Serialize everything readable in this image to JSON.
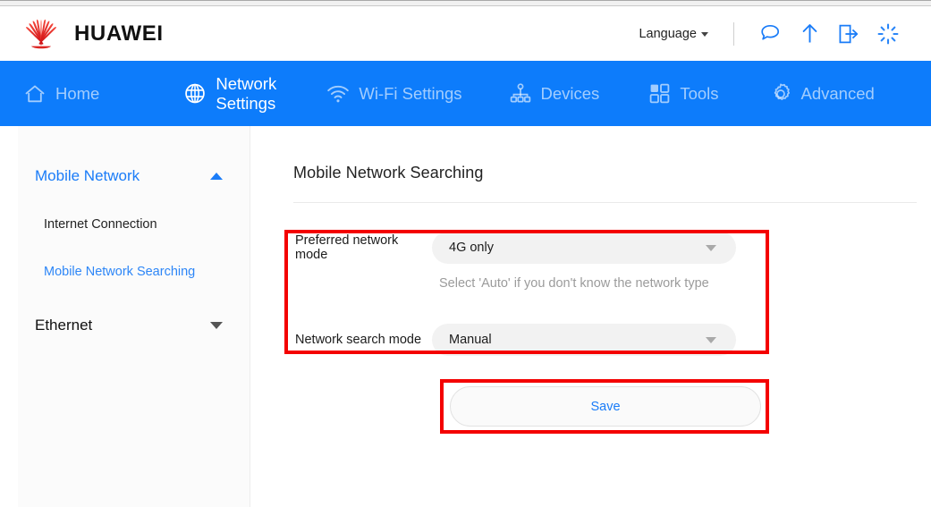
{
  "colors": {
    "nav_blue": "#0d7cfb",
    "link_blue": "#1a7cf8",
    "annotation_red": "#f40000",
    "brand_red": "#e32119",
    "field_gray": "#f2f2f2",
    "hint_gray": "#9b9b9b"
  },
  "header": {
    "brand_name": "HUAWEI",
    "logo_icon": "huawei-flower-logo",
    "language_label": "Language",
    "language_caret_icon": "caret-down-icon",
    "icons": [
      {
        "name": "sms-icon",
        "glyph": "speech-bubble"
      },
      {
        "name": "update-icon",
        "glyph": "arrow-up"
      },
      {
        "name": "logout-icon",
        "glyph": "box-arrow-right"
      },
      {
        "name": "reboot-icon",
        "glyph": "starburst-spinner"
      }
    ]
  },
  "nav": {
    "items": [
      {
        "id": "home",
        "label": "Home",
        "icon": "home-icon",
        "active": false,
        "two_line": false
      },
      {
        "id": "network",
        "label": "Network Settings",
        "icon": "globe-icon",
        "active": true,
        "two_line": true
      },
      {
        "id": "wifi",
        "label": "Wi-Fi Settings",
        "icon": "wifi-icon",
        "active": false,
        "two_line": false
      },
      {
        "id": "devices",
        "label": "Devices",
        "icon": "devices-icon",
        "active": false,
        "two_line": false
      },
      {
        "id": "tools",
        "label": "Tools",
        "icon": "grid-icon",
        "active": false,
        "two_line": false
      },
      {
        "id": "advanced",
        "label": "Advanced",
        "icon": "gear-icon",
        "active": false,
        "two_line": false
      }
    ]
  },
  "sidebar": {
    "groups": [
      {
        "id": "mobile-network",
        "label": "Mobile Network",
        "expanded": true,
        "chevron_icon": "chevron-up-icon",
        "links": [
          {
            "id": "internet-connection",
            "label": "Internet Connection",
            "active": false
          },
          {
            "id": "mobile-network-search",
            "label": "Mobile Network Searching",
            "active": true
          }
        ]
      },
      {
        "id": "ethernet",
        "label": "Ethernet",
        "expanded": false,
        "chevron_icon": "chevron-down-icon",
        "links": []
      }
    ]
  },
  "main": {
    "page_title": "Mobile Network Searching",
    "fields": [
      {
        "id": "preferred-network-mode",
        "label": "Preferred network mode",
        "value": "4G only",
        "caret_icon": "caret-down-icon",
        "hint": "Select 'Auto' if you don't know the network type"
      },
      {
        "id": "network-search-mode",
        "label": "Network search mode",
        "value": "Manual",
        "caret_icon": "caret-down-icon",
        "hint": ""
      }
    ],
    "save_label": "Save"
  }
}
